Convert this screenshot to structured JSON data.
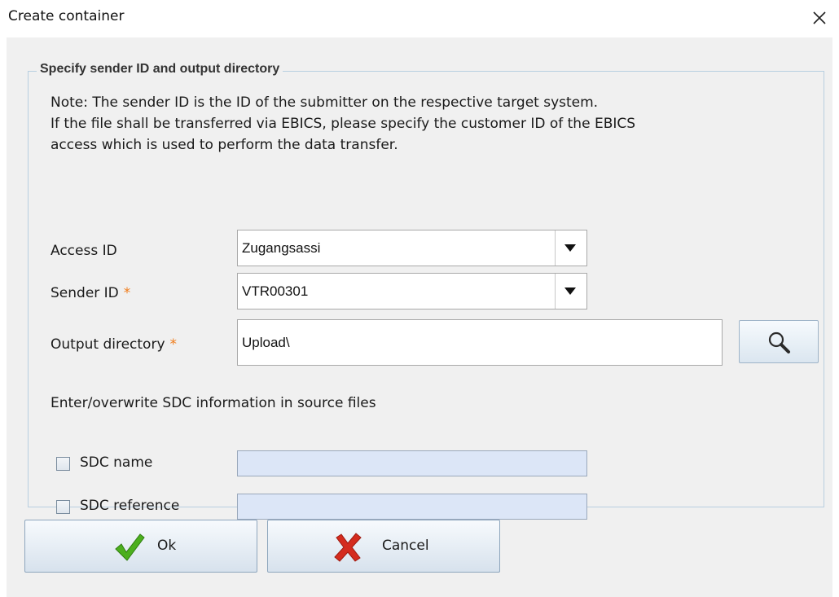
{
  "window": {
    "title": "Create container",
    "close_icon": "close-icon"
  },
  "group": {
    "legend": "Specify sender ID and output directory",
    "note_lines": [
      "Note: The sender ID is the ID of the submitter on the respective target system.",
      "If the file shall be transferred via EBICS, please specify the customer ID of the EBICS",
      "access which is used to perform the data transfer."
    ]
  },
  "form": {
    "access_id": {
      "label": "Access ID",
      "value": "Zugangsassi"
    },
    "sender_id": {
      "label": "Sender ID",
      "required_mark": "*",
      "value": "VTR00301"
    },
    "output_directory": {
      "label": "Output directory",
      "required_mark": "*",
      "value": "Upload\\",
      "browse_icon": "magnifier-icon"
    }
  },
  "sdc": {
    "heading": "Enter/overwrite SDC information in source files",
    "name": {
      "label": "SDC name",
      "checked": false,
      "value": ""
    },
    "reference": {
      "label": "SDC reference",
      "checked": false,
      "value": ""
    }
  },
  "buttons": {
    "ok": {
      "label": "Ok",
      "icon": "checkmark-icon"
    },
    "cancel": {
      "label": "Cancel",
      "icon": "x-icon"
    }
  },
  "colors": {
    "required_star": "#f07c1a",
    "ok_check": "#4caf1e",
    "cancel_x": "#d42b1e",
    "sdc_field_bg": "#dce6f7"
  }
}
